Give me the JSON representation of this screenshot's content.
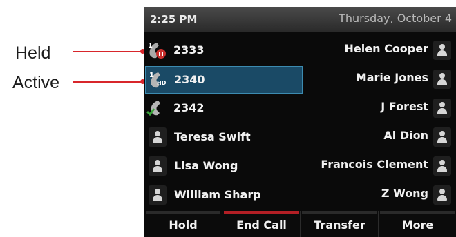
{
  "callouts": {
    "held": "Held",
    "active": "Active"
  },
  "status": {
    "time": "2:25 PM",
    "date": "Thursday, October 4"
  },
  "lines": [
    {
      "label": "2333",
      "state": "held",
      "icon": "handset-held-icon"
    },
    {
      "label": "2340",
      "state": "active",
      "icon": "handset-hd-active-icon"
    },
    {
      "label": "2342",
      "state": "idle",
      "icon": "handset-registered-icon"
    }
  ],
  "left_contacts": [
    "Teresa Swift",
    "Lisa Wong",
    "William Sharp"
  ],
  "right_contacts": [
    "Helen Cooper",
    "Marie Jones",
    "J Forest",
    "Al Dion",
    "Francois Clement",
    "Z Wong"
  ],
  "softkeys": [
    "Hold",
    "End Call",
    "Transfer",
    "More"
  ],
  "colors": {
    "accent_red": "#d8262b",
    "active_line_bg": "#1a4a66",
    "end_call_bar": "#b31f25"
  }
}
